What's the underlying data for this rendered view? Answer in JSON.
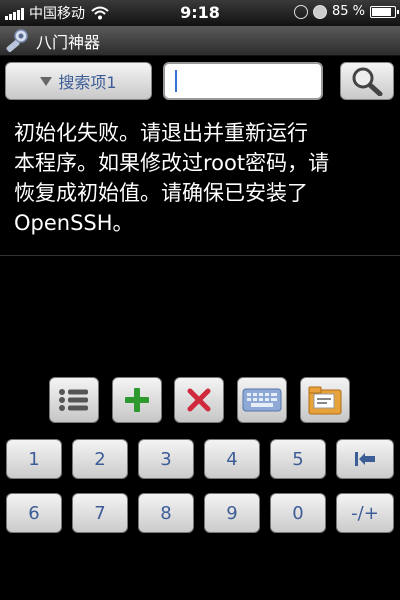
{
  "status_bar": {
    "carrier": "中国移动",
    "time": "9:18",
    "battery": "85 %",
    "battery_level": 0.85
  },
  "app": {
    "title": "八门神器"
  },
  "search": {
    "type_label": "搜索项1",
    "input_value": ""
  },
  "message": "初始化失败。请退出并重新运行\n本程序。如果修改过root密码，请\n恢复成初始值。请确保已安装了\nOpenSSH。",
  "toolbar": {
    "icons": [
      "list-icon",
      "add-icon",
      "delete-icon",
      "keyboard-icon",
      "folder-icon"
    ]
  },
  "keypad": {
    "row1": [
      "1",
      "2",
      "3",
      "4",
      "5",
      "⇤"
    ],
    "row2": [
      "6",
      "7",
      "8",
      "9",
      "0",
      "-/+"
    ]
  }
}
